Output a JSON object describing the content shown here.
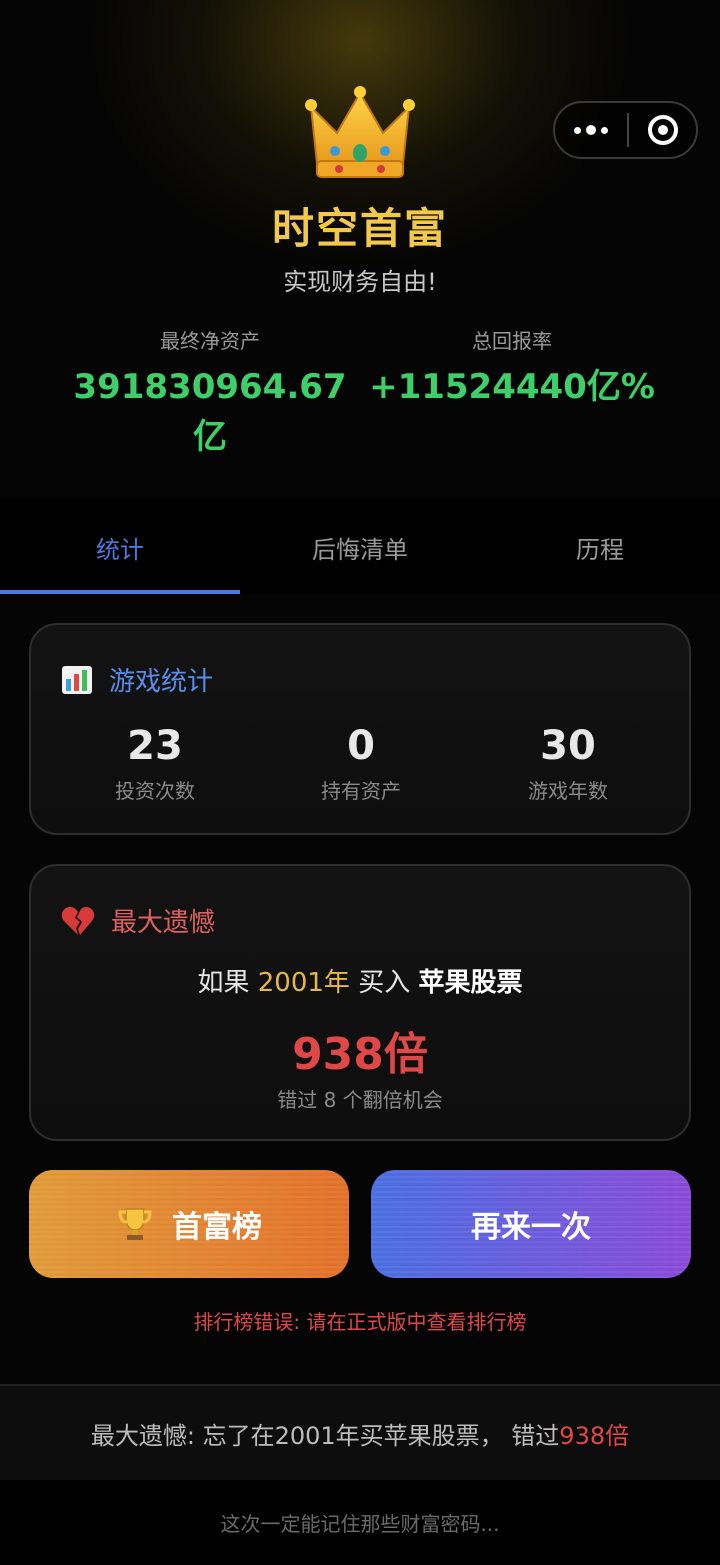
{
  "header": {
    "title": "时空首富",
    "subtitle": "实现财务自由!"
  },
  "summary": {
    "net_assets_label": "最终净资产",
    "net_assets_value": "391830964.67亿",
    "total_return_label": "总回报率",
    "total_return_value": "+11524440亿%"
  },
  "tabs": [
    {
      "label": "统计",
      "active": true
    },
    {
      "label": "后悔清单",
      "active": false
    },
    {
      "label": "历程",
      "active": false
    }
  ],
  "game_stats": {
    "title": "游戏统计",
    "icon": "bar-chart-icon",
    "items": [
      {
        "value": "23",
        "label": "投资次数"
      },
      {
        "value": "0",
        "label": "持有资产"
      },
      {
        "value": "30",
        "label": "游戏年数"
      }
    ]
  },
  "biggest_regret": {
    "title": "最大遗憾",
    "icon": "broken-heart-icon",
    "prefix": "如果",
    "year": "2001年",
    "action": "买入",
    "stock": "苹果股票",
    "multiple": "938倍",
    "missed": "错过 8 个翻倍机会"
  },
  "buttons": {
    "rank_label": "首富榜",
    "rank_icon": "trophy-icon",
    "again_label": "再来一次"
  },
  "error_text": "排行榜错误: 请在正式版中查看排行榜",
  "bottom_summary": {
    "text": "最大遗憾: 忘了在2001年买苹果股票，  错过 ",
    "highlight": "938倍"
  },
  "footer_text": "这次一定能记住那些财富密码...",
  "colors": {
    "gold": "#f2c94c",
    "green": "#3fcf6a",
    "blue": "#4a78e0",
    "red": "#e04848"
  }
}
